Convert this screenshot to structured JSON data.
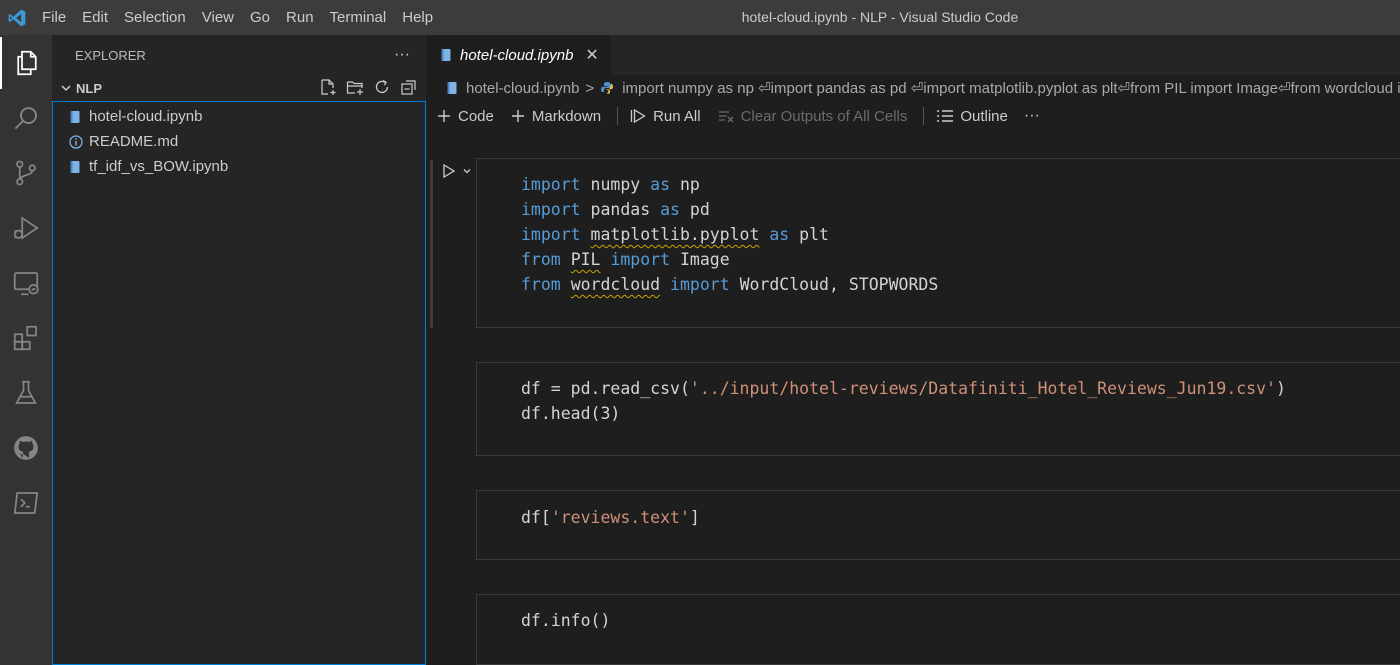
{
  "window": {
    "title": "hotel-cloud.ipynb - NLP - Visual Studio Code"
  },
  "menu": [
    "File",
    "Edit",
    "Selection",
    "View",
    "Go",
    "Run",
    "Terminal",
    "Help"
  ],
  "activity_icons": [
    "explorer-icon",
    "search-icon",
    "source-control-icon",
    "run-debug-icon",
    "remote-explorer-icon",
    "extensions-icon",
    "testing-icon",
    "github-icon",
    "terminal-icon"
  ],
  "sidebar": {
    "title": "EXPLORER",
    "more": "···",
    "folder": "NLP",
    "files": [
      {
        "name": "hotel-cloud.ipynb",
        "icon": "notebook-icon"
      },
      {
        "name": "README.md",
        "icon": "info-icon"
      },
      {
        "name": "tf_idf_vs_BOW.ipynb",
        "icon": "notebook-icon"
      }
    ]
  },
  "editor": {
    "tab": {
      "label": "hotel-cloud.ipynb",
      "close": "✕"
    },
    "breadcrumb": {
      "file": "hotel-cloud.ipynb",
      "separator": ">",
      "cell": "import numpy as np ⏎import pandas as pd ⏎import matplotlib.pyplot as plt⏎from PIL import Image⏎from wordcloud import WordCloud, STOPWORDS"
    },
    "toolbar": {
      "code": "Code",
      "markdown": "Markdown",
      "run_all": "Run All",
      "clear_outputs": "Clear Outputs of All Cells",
      "outline": "Outline",
      "more": "···"
    }
  },
  "cells": [
    {
      "lines": [
        [
          "import",
          " numpy ",
          "as",
          " np"
        ],
        [
          "import",
          " pandas ",
          "as",
          " pd"
        ],
        [
          "import",
          " ",
          "matplotlib.pyplot",
          " ",
          "as",
          " plt"
        ],
        [
          "from",
          " ",
          "PIL",
          " ",
          "import",
          " Image"
        ],
        [
          "from",
          " ",
          "wordcloud",
          " ",
          "import",
          " WordCloud, STOPWORDS"
        ]
      ]
    },
    {
      "line1_a": "df = pd.read_csv(",
      "line1_str": "'../input/hotel-reviews/Datafiniti_Hotel_Reviews_Jun19.csv'",
      "line1_b": ")",
      "line2": "df.head(3)"
    },
    {
      "a": "df[",
      "str": "'reviews.text'",
      "b": "]"
    },
    {
      "line": "df.info()"
    }
  ],
  "colors": {
    "keyword": "#569cd6",
    "string": "#ce9178",
    "accent": "#007fd4",
    "vscode_logo": "#3c99d4"
  }
}
